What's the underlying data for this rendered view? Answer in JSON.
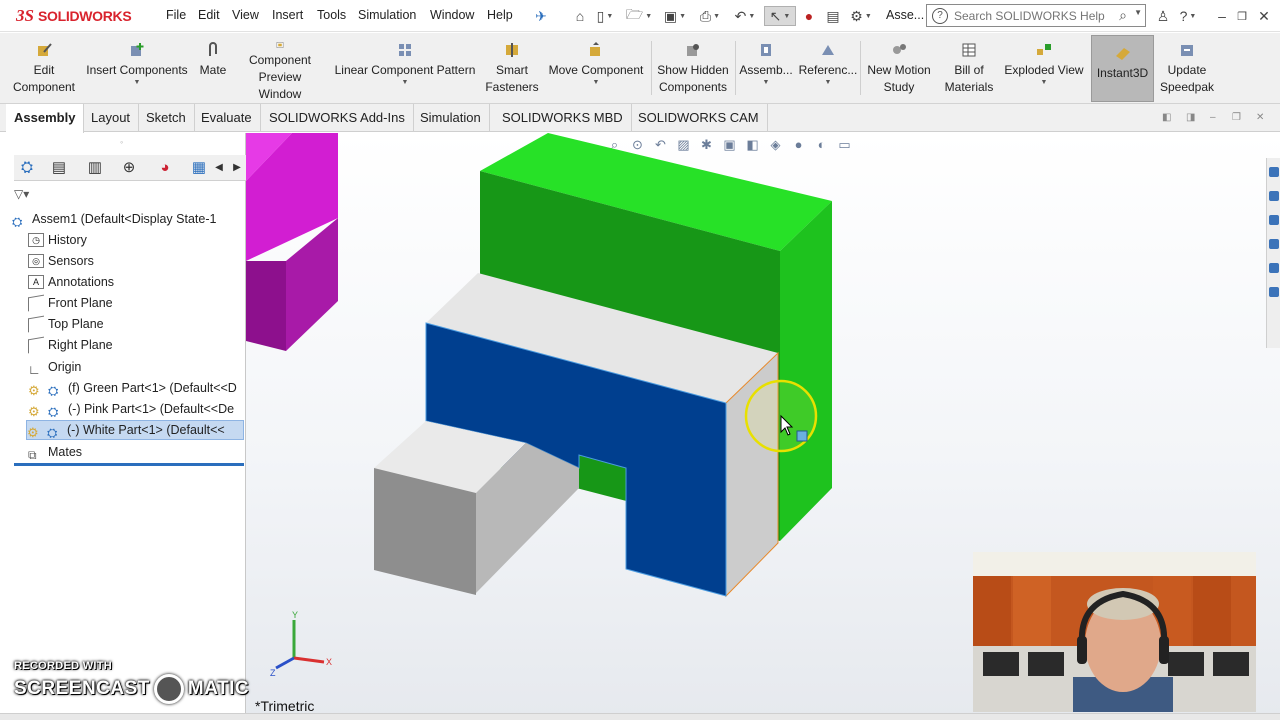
{
  "app": {
    "brand_prefix": "3S",
    "brand_name": "SOLIDWORKS"
  },
  "menu": {
    "items": [
      "File",
      "Edit",
      "View",
      "Insert",
      "Tools",
      "Simulation",
      "Window",
      "Help"
    ],
    "doc_label": "Asse..."
  },
  "search": {
    "placeholder": "Search SOLIDWORKS Help"
  },
  "ribbon": {
    "edit_component": "Edit\nComponent",
    "insert_components": "Insert Components",
    "mate": "Mate",
    "component_preview": "Component\nPreview Window",
    "linear_pattern": "Linear Component Pattern",
    "smart_fasteners": "Smart\nFasteners",
    "move_component": "Move Component",
    "show_hidden": "Show Hidden\nComponents",
    "assembly": "Assemb...",
    "reference": "Referenc...",
    "new_motion": "New Motion\nStudy",
    "bom": "Bill of\nMaterials",
    "exploded": "Exploded View",
    "instant3d": "Instant3D",
    "speedpak": "Update\nSpeedpak"
  },
  "tabs": [
    "Assembly",
    "Layout",
    "Sketch",
    "Evaluate",
    "SOLIDWORKS Add-Ins",
    "Simulation",
    "SOLIDWORKS MBD",
    "SOLIDWORKS CAM"
  ],
  "active_tab": "Assembly",
  "tree": {
    "root": "Assem1  (Default<Display State-1",
    "items": [
      "History",
      "Sensors",
      "Annotations",
      "Front Plane",
      "Top Plane",
      "Right Plane",
      "Origin"
    ],
    "components": [
      "(f) Green Part<1> (Default<<D",
      "(-) Pink Part<1> (Default<<De",
      "(-) White Part<1> (Default<<"
    ],
    "mates": "Mates"
  },
  "viewport": {
    "view_name": "*Trimetric",
    "axis_x": "X",
    "axis_y": "Y",
    "axis_z": "Z"
  },
  "watermark": {
    "recorded": "RECORDED WITH",
    "brand_left": "SCREENCAST",
    "brand_right": "MATIC"
  },
  "colors": {
    "green": "#22dd22",
    "blue": "#003f8f",
    "magenta": "#cc18cc",
    "accent": "#d9232d"
  }
}
